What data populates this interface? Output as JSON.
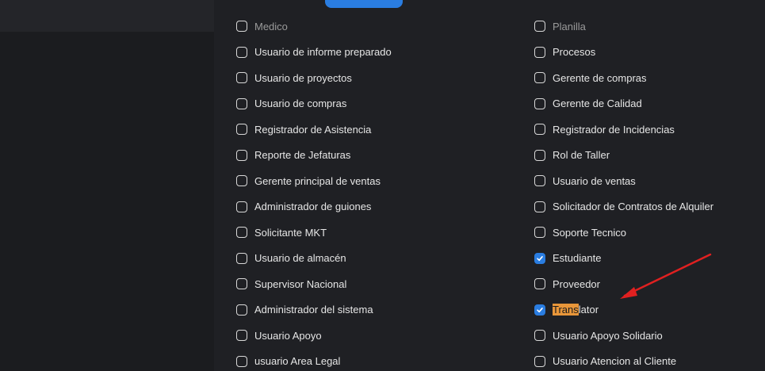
{
  "top_tab": {
    "label": ""
  },
  "columns": [
    {
      "items": [
        {
          "label": "Medico",
          "checked": false,
          "partial": true
        },
        {
          "label": "Usuario de informe preparado",
          "checked": false
        },
        {
          "label": "Usuario de proyectos",
          "checked": false
        },
        {
          "label": "Usuario de compras",
          "checked": false
        },
        {
          "label": "Registrador de Asistencia",
          "checked": false
        },
        {
          "label": "Reporte de Jefaturas",
          "checked": false
        },
        {
          "label": "Gerente principal de ventas",
          "checked": false
        },
        {
          "label": "Administrador de guiones",
          "checked": false
        },
        {
          "label": "Solicitante MKT",
          "checked": false
        },
        {
          "label": "Usuario de almacén",
          "checked": false
        },
        {
          "label": "Supervisor Nacional",
          "checked": false
        },
        {
          "label": "Administrador del sistema",
          "checked": false
        },
        {
          "label": "Usuario Apoyo",
          "checked": false
        },
        {
          "label": "usuario Area Legal",
          "checked": false
        }
      ]
    },
    {
      "items": [
        {
          "label": "Planilla",
          "checked": false,
          "partial": true
        },
        {
          "label": "Procesos",
          "checked": false
        },
        {
          "label": "Gerente de compras",
          "checked": false
        },
        {
          "label": "Gerente de Calidad",
          "checked": false
        },
        {
          "label": "Registrador de Incidencias",
          "checked": false
        },
        {
          "label": "Rol de Taller",
          "checked": false
        },
        {
          "label": "Usuario de ventas",
          "checked": false
        },
        {
          "label": "Solicitador de Contratos de Alquiler",
          "checked": false
        },
        {
          "label": "Soporte Tecnico",
          "checked": false
        },
        {
          "label": "Estudiante",
          "checked": true
        },
        {
          "label": "Proveedor",
          "checked": false
        },
        {
          "label": "Translator",
          "checked": true,
          "highlight_prefix": "Trans",
          "highlight_rest": "lator"
        },
        {
          "label": "Usuario Apoyo Solidario",
          "checked": false
        },
        {
          "label": "Usuario Atencion al Cliente",
          "checked": false
        }
      ]
    }
  ],
  "colors": {
    "background": "#1f2024",
    "checkbox_checked": "#2a7de1",
    "search_highlight": "#e8963a",
    "annotation_arrow": "#e02020"
  },
  "annotation": {
    "type": "arrow",
    "points_to": "Translator"
  }
}
